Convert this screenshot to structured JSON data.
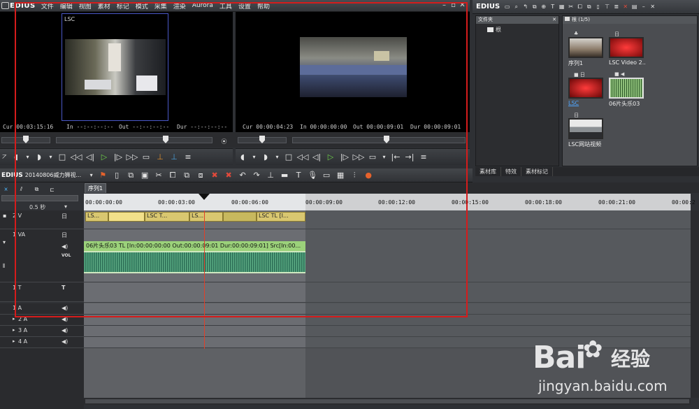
{
  "app": {
    "name": "EDIUS",
    "menu": [
      "文件",
      "编辑",
      "视图",
      "素材",
      "标记",
      "模式",
      "采集",
      "渲染",
      "Aurora",
      "工具",
      "设置",
      "帮助"
    ]
  },
  "player": {
    "cur": "Cur 00:03:15:16",
    "in": "In --:--:--:--",
    "out": "Out --:--:--:--",
    "dur": "Dur --:--:--:--",
    "label": "LSC"
  },
  "recorder": {
    "cur": "Cur 00:00:04:23",
    "in": "In 00:00:00:00",
    "out": "Out 00:00:09:01",
    "dur": "Dur 00:00:09:01"
  },
  "bin": {
    "title": "EDIUS",
    "folder_header": "文件夹",
    "root_folder": "根",
    "clip_header": "根 (1/5)",
    "clips": [
      {
        "label": "序列1",
        "icon": "sequence-icon",
        "selected": false
      },
      {
        "label": "LSC Video 2...",
        "icon": "video-icon",
        "selected": false
      },
      {
        "label": "LSC",
        "icon": "video-icon",
        "selected": true
      },
      {
        "label": "06片头乐03",
        "icon": "audio-icon",
        "selected": false
      },
      {
        "label": "LSC网站视频",
        "icon": "video-icon",
        "selected": false
      }
    ],
    "tabs": [
      "素材库",
      "特效",
      "素材标记"
    ]
  },
  "timeline": {
    "title": "EDIUS",
    "project": "20140806威力狮视...",
    "sequence_tab": "序列1",
    "zoom": "0.5 秒",
    "ruler_marks": [
      "00:00:00:00",
      "00:00:03:00",
      "00:00:06:00",
      "00:00:09:00",
      "00:00:12:00",
      "00:00:15:00",
      "00:00:18:00",
      "00:00:21:00",
      "00:00:2"
    ],
    "tracks": {
      "v2": "2 V",
      "va1": "1 VA",
      "vol": "VOL",
      "t1": "1 T",
      "a1": "1 A",
      "a2": "2 A",
      "a3": "3 A",
      "a4": "4 A"
    },
    "video_clips": [
      "LS...",
      "LSC  T...",
      "LS...",
      "LSC  TL [I..."
    ],
    "audio_clip": "06片头乐03  TL [In:00:00:00:00  Out:00:00:09:01  Dur:00:00:09:01]  Src[In:00..."
  },
  "watermark": {
    "brand": "Bai",
    "brand2": "经验",
    "url": "jingyan.baidu.com"
  },
  "colors": {
    "accent": "#d51c1c",
    "clip_video": "#d9c770",
    "clip_audio": "#9bd17a",
    "play_green": "#6fd14a"
  }
}
